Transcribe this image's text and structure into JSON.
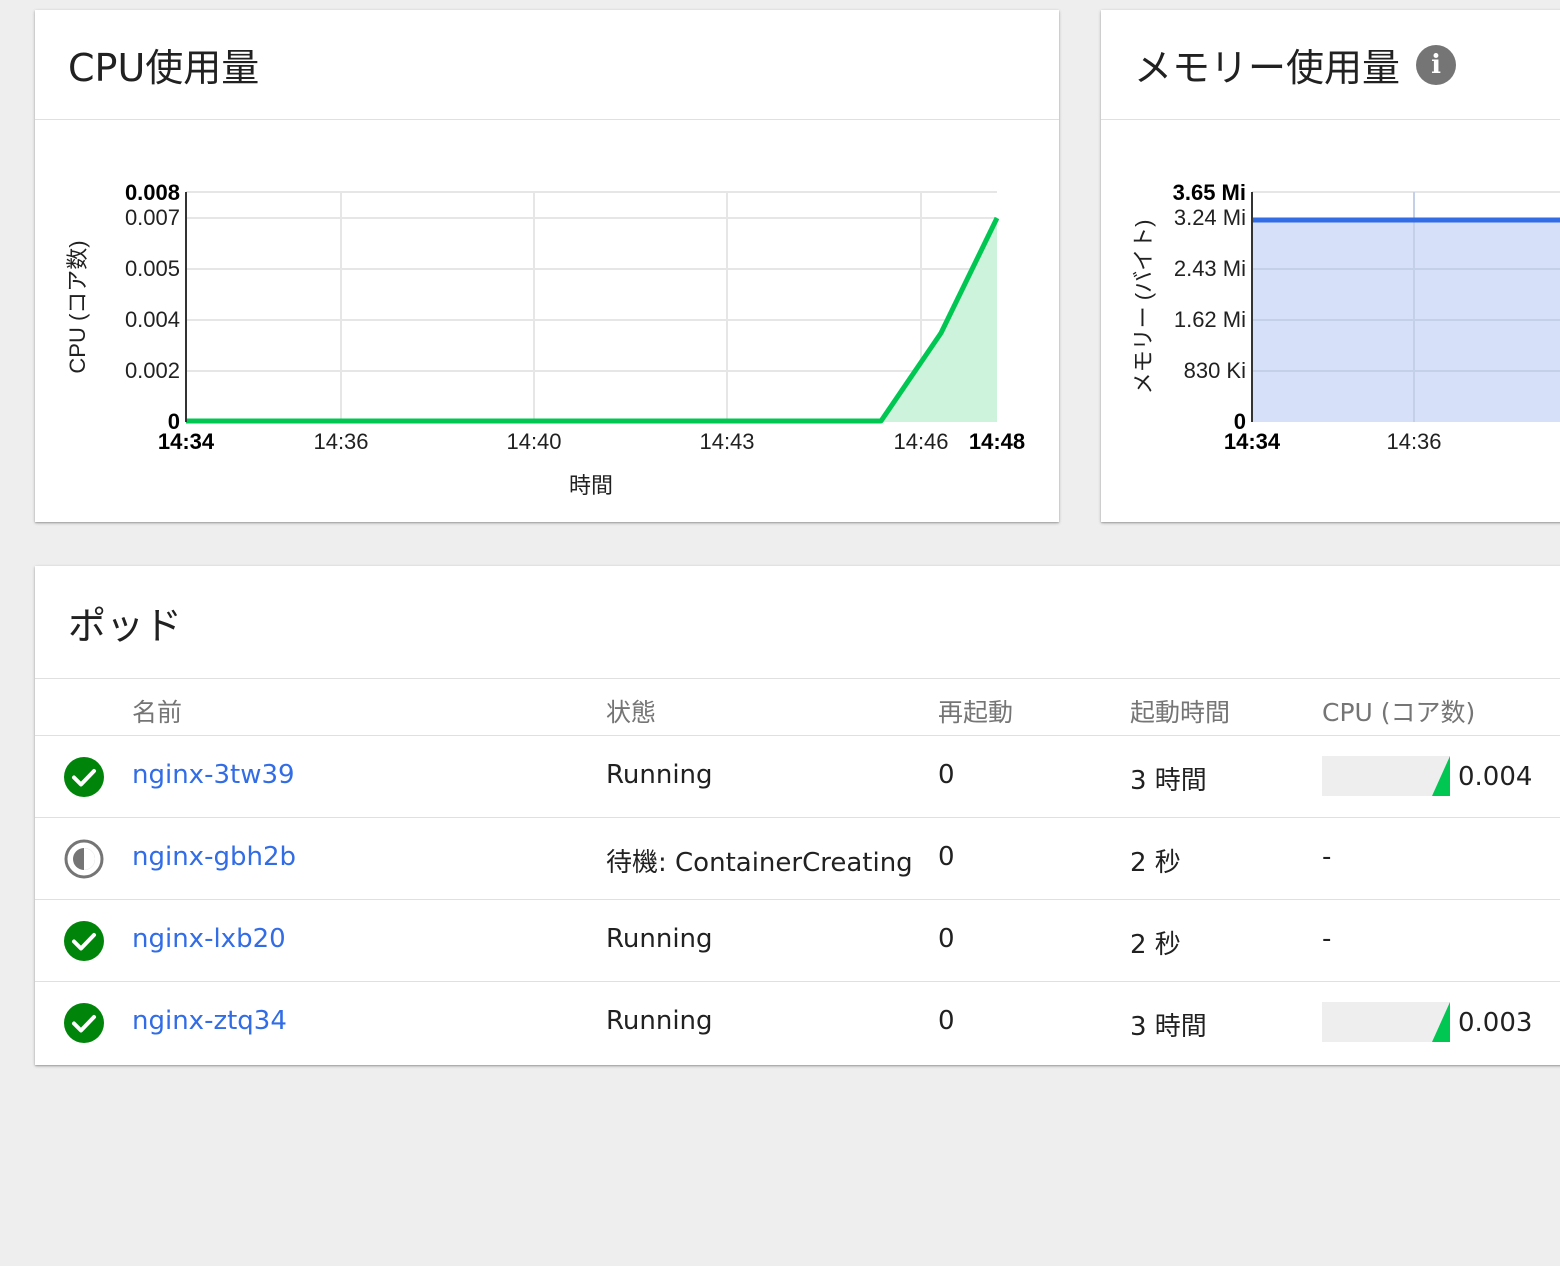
{
  "cpu_card": {
    "title": "CPU使用量",
    "chart_data": {
      "type": "area",
      "title": "",
      "xlabel": "時間",
      "ylabel": "CPU (コア数)",
      "x_ticks": [
        "14:34",
        "14:36",
        "14:40",
        "14:43",
        "14:46",
        "14:48"
      ],
      "x_tick_bold": [
        "14:34",
        "14:48"
      ],
      "y_ticks": [
        "0",
        "0.002",
        "0.004",
        "0.005",
        "0.007",
        "0.008"
      ],
      "y_tick_bold": [
        "0",
        "0.008"
      ],
      "ylim": [
        0,
        0.008
      ],
      "grid": true,
      "color": "#00c752",
      "fill_color": "#cdf3dc",
      "series": [
        {
          "x": [
            "14:34",
            "14:45",
            "14:46",
            "14:48"
          ],
          "values": [
            0,
            0,
            0.0035,
            0.007
          ]
        }
      ]
    }
  },
  "mem_card": {
    "title": "メモリー使用量",
    "info_icon": "info-icon",
    "chart_data": {
      "type": "area",
      "title": "",
      "xlabel": "",
      "ylabel": "メモリー (バイト)",
      "x_ticks": [
        "14:34",
        "14:36"
      ],
      "x_tick_bold": [
        "14:34"
      ],
      "y_ticks": [
        "0",
        "830 Ki",
        "1.62 Mi",
        "2.43 Mi",
        "3.24 Mi",
        "3.65 Mi"
      ],
      "y_tick_bold": [
        "0",
        "3.65 Mi"
      ],
      "ylim": [
        "0",
        "3.65 Mi"
      ],
      "grid": true,
      "color": "#326de6",
      "fill_color": "#d6e0f8",
      "series": [
        {
          "x": [
            "14:34",
            "14:36"
          ],
          "values": [
            "3.18 Mi",
            "3.18 Mi"
          ]
        }
      ]
    }
  },
  "pods_card": {
    "title": "ポッド",
    "columns": [
      "名前",
      "状態",
      "再起動",
      "起動時間",
      "CPU (コア数)"
    ],
    "rows": [
      {
        "status_icon": "check-circle-icon",
        "name": "nginx-3tw39",
        "state": "Running",
        "restarts": "0",
        "age": "3 時間",
        "cpu": "0.004",
        "cpu_sparkline": [
          0,
          0.004
        ]
      },
      {
        "status_icon": "pending-clock-icon",
        "name": "nginx-gbh2b",
        "state": "待機: ContainerCreating",
        "restarts": "0",
        "age": "2 秒",
        "cpu": "-"
      },
      {
        "status_icon": "check-circle-icon",
        "name": "nginx-lxb20",
        "state": "Running",
        "restarts": "0",
        "age": "2 秒",
        "cpu": "-"
      },
      {
        "status_icon": "check-circle-icon",
        "name": "nginx-ztq34",
        "state": "Running",
        "restarts": "0",
        "age": "3 時間",
        "cpu": "0.003",
        "cpu_sparkline": [
          0,
          0.003
        ]
      }
    ]
  },
  "colors": {
    "accent": "#326de6",
    "success": "#00850a",
    "cpu_green": "#00c752"
  }
}
